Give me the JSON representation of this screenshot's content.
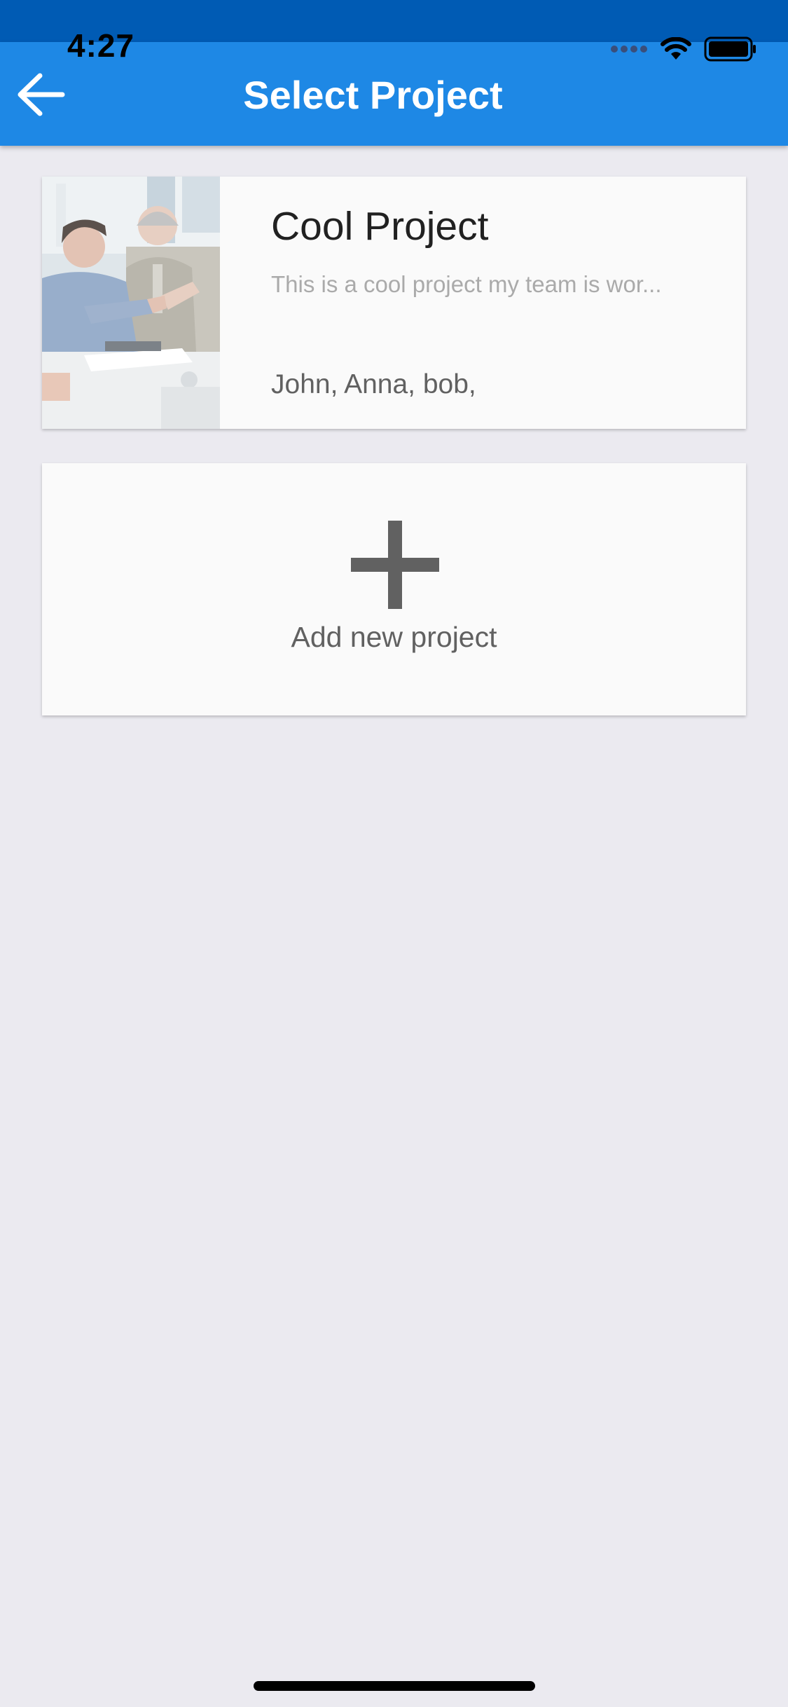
{
  "status_bar": {
    "time": "4:27",
    "icons": [
      "signal-icon",
      "wifi-icon",
      "battery-icon"
    ]
  },
  "app_bar": {
    "title": "Select Project",
    "back_icon": "arrow-left-icon",
    "color": "#1e88e5"
  },
  "projects": [
    {
      "name": "Cool Project",
      "description": "This is a cool project my team is wor...",
      "members": "John, Anna, bob,",
      "image": "team-meeting-photo"
    }
  ],
  "add_project": {
    "label": "Add new project",
    "icon": "plus-icon"
  }
}
